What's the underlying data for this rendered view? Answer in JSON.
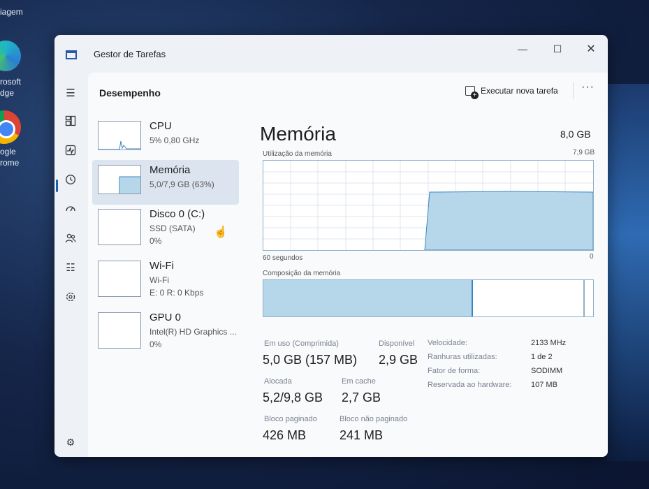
{
  "desktop": {
    "text_top": "iagem",
    "edge_label": [
      "rosoft",
      "dge"
    ],
    "chrome_label": [
      "ogle",
      "rome"
    ]
  },
  "window": {
    "title": "Gestor de Tarefas",
    "controls": {
      "minimize": "—",
      "maximize": "☐",
      "close": "✕"
    }
  },
  "header": {
    "page_title": "Desempenho",
    "run_task_label": "Executar nova tarefa",
    "more_label": "···"
  },
  "nav_icons": [
    "hamburger-icon",
    "processes-icon",
    "performance-icon",
    "history-icon",
    "startup-icon",
    "users-icon",
    "details-icon",
    "services-icon",
    "settings-icon"
  ],
  "devices": [
    {
      "name": "CPU",
      "sub": "5% 0,80 GHz",
      "sub2": ""
    },
    {
      "name": "Memória",
      "sub": "5,0/7,9 GB (63%)",
      "sub2": ""
    },
    {
      "name": "Disco 0 (C:)",
      "sub": "SSD (SATA)",
      "sub2": "0%"
    },
    {
      "name": "Wi-Fi",
      "sub": "Wi-Fi",
      "sub2": "E: 0 R: 0 Kbps"
    },
    {
      "name": "GPU 0",
      "sub": "Intel(R) HD Graphics ...",
      "sub2": "0%"
    }
  ],
  "memory": {
    "title": "Memória",
    "total": "8,0 GB",
    "usage_label": "Utilização da memória",
    "usage_max": "7,9 GB",
    "time_left": "60 segundos",
    "time_right": "0",
    "composition_label": "Composição da memória",
    "usage_fraction_current": 0.63,
    "stats": {
      "in_use_label": "Em uso (Comprimida)",
      "in_use_value": "5,0 GB (157 MB)",
      "available_label": "Disponível",
      "available_value": "2,9 GB",
      "committed_label": "Alocada",
      "committed_value": "5,2/9,8 GB",
      "cached_label": "Em cache",
      "cached_value": "2,7 GB",
      "paged_label": "Bloco paginado",
      "paged_value": "426 MB",
      "nonpaged_label": "Bloco não paginado",
      "nonpaged_value": "241 MB"
    },
    "details": [
      {
        "key": "Velocidade:",
        "value": "2133 MHz"
      },
      {
        "key": "Ranhuras utilizadas:",
        "value": "1 de 2"
      },
      {
        "key": "Fator de forma:",
        "value": "SODIMM"
      },
      {
        "key": "Reservada ao hardware:",
        "value": "107 MB"
      }
    ]
  },
  "colors": {
    "graph_fill": "#b6d6ea",
    "graph_line": "#3a86c4",
    "selected_bg": "#dce4ef"
  }
}
